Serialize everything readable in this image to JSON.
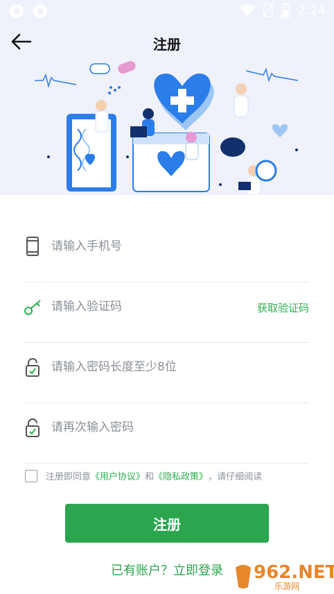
{
  "status_bar": {
    "time": "2:24"
  },
  "header": {
    "title": "注册"
  },
  "form": {
    "phone_placeholder": "请输入手机号",
    "code_placeholder": "请输入验证码",
    "get_code_label": "获取验证码",
    "password_placeholder": "请输入密码长度至少8位",
    "confirm_placeholder": "请再次输入密码"
  },
  "agreement": {
    "prefix": "注册即同意",
    "user_agreement": "《用户协议》",
    "and": "和",
    "privacy_policy": "《隐私政策》",
    "suffix": "，请仔细阅读"
  },
  "submit_label": "注册",
  "login_link": "已有账户？立即登录",
  "watermark": {
    "brand": "962.NET",
    "sub": "乐游网"
  },
  "colors": {
    "accent": "#2ba64e",
    "header_bg": "#eff1fb",
    "illustration_blue": "#2b7de9"
  }
}
